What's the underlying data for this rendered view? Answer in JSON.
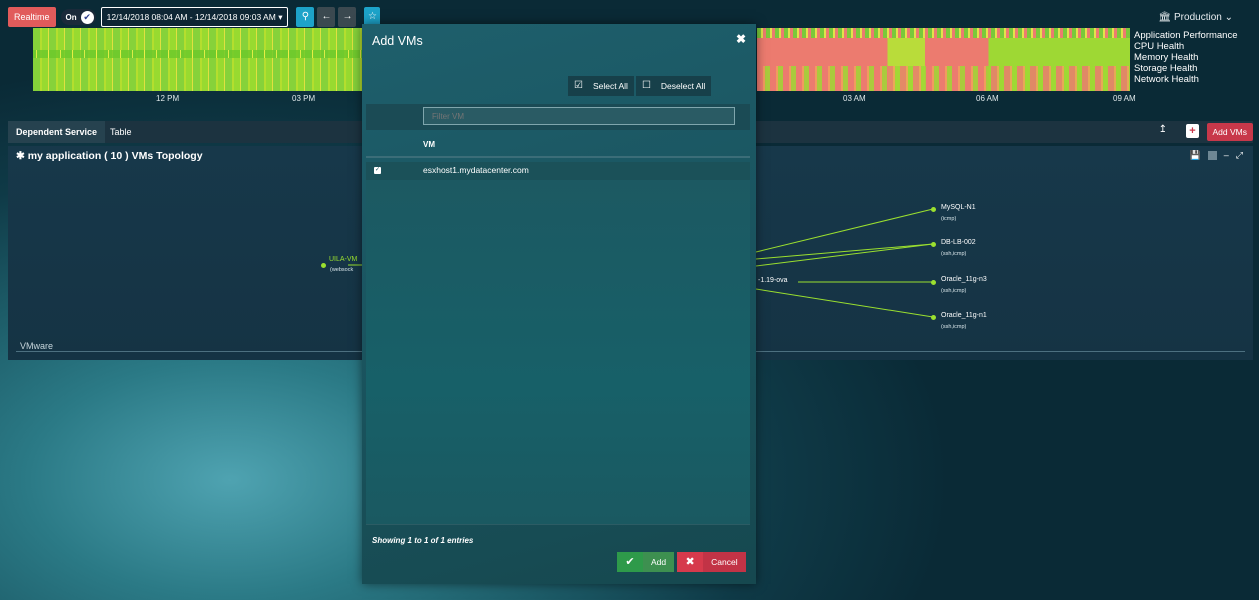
{
  "toolbar": {
    "realtime_label": "Realtime",
    "toggle_label": "On",
    "date_range": "12/14/2018 08:04 AM - 12/14/2018 09:03 AM",
    "date_caret": "▾"
  },
  "timeline": {
    "left_labels": [
      "12 PM",
      "03 PM"
    ],
    "right_labels": [
      "03 AM",
      "06 AM",
      "09 AM"
    ]
  },
  "environment": {
    "label": "Production",
    "caret": "⌄"
  },
  "health_legend": [
    "Application Performance",
    "CPU Health",
    "Memory Health",
    "Storage Health",
    "Network Health"
  ],
  "tabs": [
    {
      "label": "Dependent Service",
      "active": true
    },
    {
      "label": "Table",
      "active": false
    }
  ],
  "actions": {
    "add_vms_label": "Add VMs"
  },
  "topology": {
    "title": "✱ my application ( 10 ) VMs Topology",
    "center_node": "UILA-VM",
    "center_sub": "(websock",
    "partial_label": "-1.19-ova",
    "nodes": [
      {
        "name": "MySQL-N1",
        "sub": "(icmp)"
      },
      {
        "name": "DB-LB-002",
        "sub": "(ssh,icmp)"
      },
      {
        "name": "Oracle_11g-n3",
        "sub": "(ssh,icmp)"
      },
      {
        "name": "Oracle_11g-n1",
        "sub": "(ssh,icmp)"
      }
    ],
    "group_label": "VMware"
  },
  "modal": {
    "title": "Add VMs",
    "select_all": "Select All",
    "deselect_all": "Deselect All",
    "filter_placeholder": "Filter VM",
    "column_vm": "VM",
    "rows": [
      {
        "name": "esxhost1.mydatacenter.com",
        "checked": true
      }
    ],
    "showing": "Showing 1 to 1 of 1 entries",
    "add_label": "Add",
    "cancel_label": "Cancel"
  },
  "colors": {
    "realtime": "#e15b5b",
    "accent_cyan": "#1da3c9",
    "add_vms": "#c8384a",
    "add_green": "#3d9050",
    "cancel_red": "#c23346",
    "node_green": "#9be02f"
  }
}
